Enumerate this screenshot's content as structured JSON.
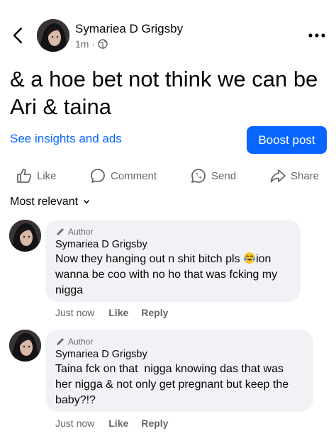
{
  "header": {
    "author_name": "Symariea D Grigsby",
    "time": "1m",
    "separator": "·",
    "back_icon": "chevron-left-icon",
    "more_icon": "more-horizontal-icon",
    "privacy_icon": "globe-icon"
  },
  "post": {
    "text": "& a hoe bet not think we can be Ari & taina"
  },
  "insights": {
    "link_label": "See insights and ads",
    "boost_label": "Boost post",
    "accent": "#0866ff"
  },
  "actions": {
    "like": "Like",
    "comment": "Comment",
    "send": "Send",
    "share": "Share"
  },
  "sort": {
    "label": "Most relevant"
  },
  "comments": [
    {
      "badge": "Author",
      "name": "Symariea D Grigsby",
      "lines": [
        "Now they hanging out n shit bitch pls",
        "wanna be coo with no ho that was fcking my",
        "nigga"
      ],
      "line1_suffix": "ion",
      "emoji": "tears-of-joy-emoji",
      "time": "Just now",
      "like": "Like",
      "reply": "Reply"
    },
    {
      "badge": "Author",
      "name": "Symariea D Grigsby",
      "lines": [
        "Taina fck on that  nigga knowing das that was",
        "her nigga & not only get pregnant but keep the",
        "baby?!?"
      ],
      "time": "Just now",
      "like": "Like",
      "reply": "Reply"
    }
  ]
}
